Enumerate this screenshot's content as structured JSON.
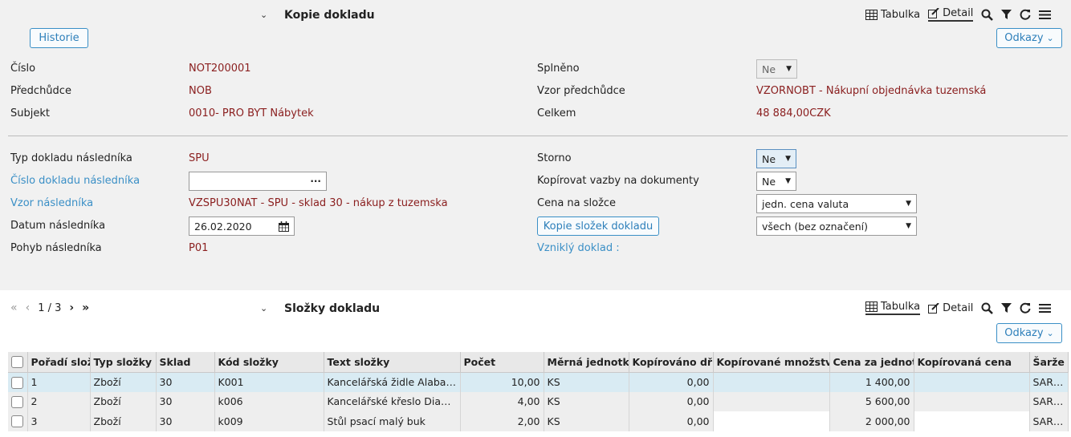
{
  "header": {
    "title": "Kopie dokladu",
    "toolbar": {
      "tabulka": "Tabulka",
      "detail": "Detail"
    },
    "historie_btn": "Historie",
    "odkazy_btn": "Odkazy"
  },
  "form_top": {
    "cislo": {
      "label": "Číslo",
      "value": "NOT200001"
    },
    "predchudce": {
      "label": "Předchůdce",
      "value": "NOB"
    },
    "subjekt": {
      "label": "Subjekt",
      "value": "0010- PRO BYT Nábytek"
    },
    "splneno": {
      "label": "Splněno",
      "value": "Ne"
    },
    "vzor_predchudce": {
      "label": "Vzor předchůdce",
      "code": "VZORNOBT",
      "desc": "- Nákupní objednávka tuzemská"
    },
    "celkem": {
      "label": "Celkem",
      "value": "48 884,00",
      "currency": "CZK"
    }
  },
  "form_bottom": {
    "typ": {
      "label": "Typ dokladu následníka",
      "value": "SPU"
    },
    "cislo_nasl": {
      "label": "Číslo dokladu následníka",
      "value": ""
    },
    "vzor_nasl": {
      "label": "Vzor následníka",
      "code": "VZSPU30NAT",
      "desc": "- SPU - sklad 30 - nákup z tuzemska"
    },
    "datum": {
      "label": "Datum následníka",
      "value": "26.02.2020"
    },
    "pohyb": {
      "label": "Pohyb následníka",
      "value": "P01"
    },
    "storno": {
      "label": "Storno",
      "value": "Ne"
    },
    "kopirovat": {
      "label": "Kopírovat vazby na dokumenty",
      "value": "Ne"
    },
    "cena": {
      "label": "Cena na složce",
      "value": "jedn. cena valuta"
    },
    "kopie_slozek_btn": "Kopie složek dokladu",
    "kopie_select": "všech (bez označení)",
    "vznikly": {
      "label": "Vzniklý doklad :"
    }
  },
  "grid_section": {
    "title": "Složky dokladu",
    "pager": "1 / 3",
    "toolbar": {
      "tabulka": "Tabulka",
      "detail": "Detail"
    },
    "odkazy_btn": "Odkazy",
    "columns": [
      "Pořadí složky",
      "Typ složky",
      "Sklad",
      "Kód složky",
      "Text složky",
      "Počet",
      "Měrná jednotka",
      "Kopírováno dříve",
      "Kopírované množství",
      "Cena za jednotku",
      "Kopírovaná cena",
      "Šarže"
    ],
    "rows": [
      [
        "1",
        "Zboží",
        "30",
        "K001",
        "Kancelářská židle Alabama",
        "10,00",
        "KS",
        "0,00",
        "",
        "1 400,00",
        "",
        "SARZE"
      ],
      [
        "2",
        "Zboží",
        "30",
        "k006",
        "Kancelářské křeslo Diamond",
        "4,00",
        "KS",
        "0,00",
        "",
        "5 600,00",
        "",
        "SARZE"
      ],
      [
        "3",
        "Zboží",
        "30",
        "k009",
        "Stůl psací malý buk",
        "2,00",
        "KS",
        "0,00",
        "",
        "2 000,00",
        "",
        "SARZE"
      ]
    ]
  },
  "icons": {
    "search": "search-icon",
    "filter": "filter-icon",
    "refresh": "refresh-icon",
    "menu": "menu-icon",
    "table": "table-icon",
    "edit": "edit-icon",
    "calendar": "calendar-icon",
    "chevron": "chevron-down-icon"
  }
}
